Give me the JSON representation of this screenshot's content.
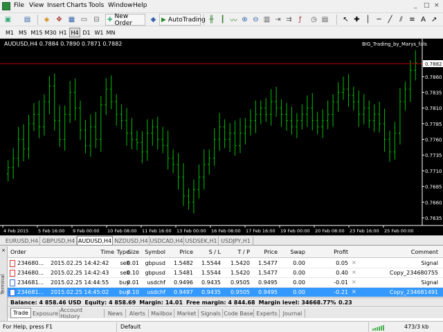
{
  "menu": [
    "File",
    "View",
    "Insert",
    "Charts",
    "Tools",
    "Window",
    "Help"
  ],
  "window_controls": [
    "_",
    "□",
    "×"
  ],
  "toolbar": {
    "new_order": "New Order",
    "autotrading": "AutoTrading"
  },
  "timeframes": [
    "M1",
    "M5",
    "M15",
    "M30",
    "H1",
    "H4",
    "D1",
    "W1",
    "MN"
  ],
  "active_timeframe": "H4",
  "chart": {
    "info": "AUDUSD,H4  0.7884 0.7890 0.7871 0.7882",
    "ea_name": "BIG_Trading_by_Marys_fals",
    "current_price_label": "0.7882",
    "price_axis": [
      "0.7882",
      "0.7860",
      "0.7835",
      "0.7810",
      "0.7785",
      "0.7760",
      "0.7735",
      "0.7710",
      "0.7685",
      "0.7660",
      "0.7635"
    ],
    "time_axis": [
      "4 Feb 2015",
      "5 Feb 16:00",
      "9 Feb 00:00",
      "10 Feb 08:00",
      "11 Feb 16:00",
      "13 Feb 00:00",
      "16 Feb 08:00",
      "17 Feb 16:00",
      "19 Feb 00:00",
      "20 Feb 08:00",
      "23 Feb 16:00",
      "25 Feb 00:00"
    ],
    "colors": {
      "bull": "#00c000",
      "bear": "#00c000",
      "bg": "#000000",
      "price_line": "#c00000"
    }
  },
  "chart_data": {
    "type": "line",
    "symbol": "AUDUSD",
    "timeframe": "H4",
    "ohlc_header": {
      "open": 0.7884,
      "high": 0.789,
      "low": 0.7871,
      "close": 0.7882
    },
    "ylim": [
      0.7625,
      0.7905
    ],
    "close_prices": [
      0.7715,
      0.773,
      0.776,
      0.7745,
      0.7785,
      0.78,
      0.778,
      0.782,
      0.7845,
      0.779,
      0.776,
      0.78,
      0.7835,
      0.781,
      0.7775,
      0.775,
      0.778,
      0.776,
      0.7815,
      0.784,
      0.782,
      0.78,
      0.779,
      0.777,
      0.776,
      0.7755,
      0.774,
      0.777,
      0.778,
      0.776,
      0.775,
      0.773,
      0.772,
      0.77,
      0.767,
      0.766,
      0.768,
      0.77,
      0.772,
      0.773,
      0.776,
      0.778,
      0.776,
      0.777,
      0.775,
      0.777,
      0.778,
      0.779,
      0.78,
      0.781,
      0.78,
      0.782,
      0.781,
      0.78,
      0.779,
      0.778,
      0.779,
      0.78,
      0.781,
      0.779,
      0.778,
      0.779,
      0.78,
      0.782,
      0.7835,
      0.784,
      0.783,
      0.782,
      0.78,
      0.781,
      0.779,
      0.78,
      0.7785,
      0.776,
      0.774,
      0.777,
      0.782,
      0.784,
      0.787,
      0.7882
    ]
  },
  "chart_tabs": [
    "EURUSD,H4",
    "GBPUSD,H4",
    "AUDUSD,H4",
    "NZDUSD,H4",
    "USDCAD,H4",
    "USDSEK,H1",
    "USDJPY,H1"
  ],
  "active_chart_tab": "AUDUSD,H4",
  "terminal": {
    "side_label": "Terminal",
    "columns": [
      "Order",
      "Time",
      "Type",
      "Size",
      "Symbol",
      "Price",
      "S / L",
      "T / P",
      "Price",
      "Swap",
      "Profit",
      "Comment"
    ],
    "rows": [
      {
        "order": "234680...",
        "time": "2015.02.25 14:42:42",
        "type": "sell",
        "size": "0.01",
        "symbol": "gbpusd",
        "price": "1.5482",
        "sl": "1.5544",
        "tp": "1.5420",
        "cur_price": "1.5477",
        "swap": "0.00",
        "profit": "0.05",
        "comment": "Signal"
      },
      {
        "order": "234680...",
        "time": "2015.02.25 14:42:43",
        "type": "sell",
        "size": "0.10",
        "symbol": "gbpusd",
        "price": "1.5481",
        "sl": "1.5544",
        "tp": "1.5420",
        "cur_price": "1.5477",
        "swap": "0.00",
        "profit": "0.40",
        "comment": "Copy_234680755"
      },
      {
        "order": "234681...",
        "time": "2015.02.25 14:44:55",
        "type": "buy",
        "size": "0.01",
        "symbol": "usdchf",
        "price": "0.9496",
        "sl": "0.9435",
        "tp": "0.9505",
        "cur_price": "0.9495",
        "swap": "0.00",
        "profit": "-0.01",
        "comment": "Signal"
      },
      {
        "order": "234681...",
        "time": "2015.02.25 14:45:02",
        "type": "buy",
        "size": "0.10",
        "symbol": "usdchf",
        "price": "0.9497",
        "sl": "0.9435",
        "tp": "0.9505",
        "cur_price": "0.9495",
        "swap": "0.00",
        "profit": "-0.21",
        "comment": "Copy_234681491"
      }
    ],
    "balance": {
      "balance": "Balance: 4 858.46 USD",
      "equity": "Equity: 4 858.69",
      "margin": "Margin: 14.01",
      "free_margin": "Free margin: 4 844.68",
      "margin_level": "Margin level: 34668.77%",
      "total_profit": "0.23"
    },
    "tabs": [
      "Trade",
      "Exposure",
      "Account History",
      "News",
      "Alerts",
      "Mailbox",
      "Market",
      "Signals",
      "Code Base",
      "Experts",
      "Journal"
    ],
    "active_tab": "Trade"
  },
  "status": {
    "help": "For Help, press F1",
    "profile": "Default",
    "traffic": "473/3 kb"
  }
}
